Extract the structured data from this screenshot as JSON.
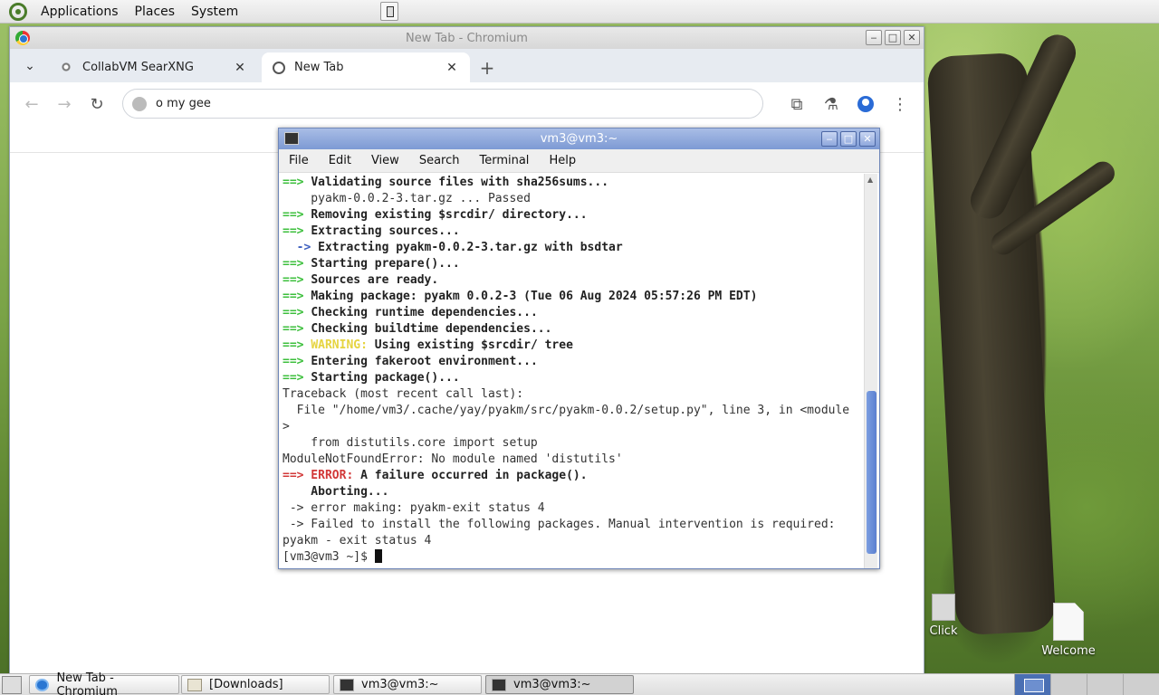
{
  "top_panel": {
    "menus": [
      "Applications",
      "Places",
      "System"
    ]
  },
  "chromium": {
    "window_title": "New Tab - Chromium",
    "tabs": [
      {
        "label": "CollabVM SearXNG",
        "active": false
      },
      {
        "label": "New Tab",
        "active": true
      }
    ],
    "new_tab_symbol": "+",
    "omnibox": {
      "value": "o my gee"
    }
  },
  "terminal": {
    "window_title": "vm3@vm3:~",
    "menus": [
      "File",
      "Edit",
      "View",
      "Search",
      "Terminal",
      "Help"
    ],
    "lines": [
      [
        [
          "g",
          "==> "
        ],
        [
          "b",
          "Validating source files with sha256sums..."
        ]
      ],
      [
        [
          "n",
          "    pyakm-0.0.2-3.tar.gz ... Passed"
        ]
      ],
      [
        [
          "g",
          "==> "
        ],
        [
          "b",
          "Removing existing $srcdir/ directory..."
        ]
      ],
      [
        [
          "g",
          "==> "
        ],
        [
          "b",
          "Extracting sources..."
        ]
      ],
      [
        [
          "n",
          "  "
        ],
        [
          "bl",
          "-> "
        ],
        [
          "b",
          "Extracting pyakm-0.0.2-3.tar.gz with bsdtar"
        ]
      ],
      [
        [
          "g",
          "==> "
        ],
        [
          "b",
          "Starting prepare()..."
        ]
      ],
      [
        [
          "g",
          "==> "
        ],
        [
          "b",
          "Sources are ready."
        ]
      ],
      [
        [
          "g",
          "==> "
        ],
        [
          "b",
          "Making package: pyakm 0.0.2-3 (Tue 06 Aug 2024 05:57:26 PM EDT)"
        ]
      ],
      [
        [
          "g",
          "==> "
        ],
        [
          "b",
          "Checking runtime dependencies..."
        ]
      ],
      [
        [
          "g",
          "==> "
        ],
        [
          "b",
          "Checking buildtime dependencies..."
        ]
      ],
      [
        [
          "g",
          "==> "
        ],
        [
          "y",
          "WARNING:"
        ],
        [
          "b",
          " Using existing $srcdir/ tree"
        ]
      ],
      [
        [
          "g",
          "==> "
        ],
        [
          "b",
          "Entering fakeroot environment..."
        ]
      ],
      [
        [
          "g",
          "==> "
        ],
        [
          "b",
          "Starting package()..."
        ]
      ],
      [
        [
          "n",
          "Traceback (most recent call last):"
        ]
      ],
      [
        [
          "n",
          "  File \"/home/vm3/.cache/yay/pyakm/src/pyakm-0.0.2/setup.py\", line 3, in <module"
        ]
      ],
      [
        [
          "n",
          ">"
        ]
      ],
      [
        [
          "n",
          "    from distutils.core import setup"
        ]
      ],
      [
        [
          "n",
          "ModuleNotFoundError: No module named 'distutils'"
        ]
      ],
      [
        [
          "r",
          "==> ERROR:"
        ],
        [
          "b",
          " A failure occurred in package()."
        ]
      ],
      [
        [
          "b",
          "    Aborting..."
        ]
      ],
      [
        [
          "n",
          " -> error making: pyakm-exit status 4"
        ]
      ],
      [
        [
          "n",
          " -> Failed to install the following packages. Manual intervention is required:"
        ]
      ],
      [
        [
          "n",
          "pyakm - exit status 4"
        ]
      ],
      [
        [
          "n",
          "[vm3@vm3 ~]$ "
        ]
      ]
    ]
  },
  "desktop_icons": [
    {
      "label": "Click",
      "type": "box"
    },
    {
      "label": "Welcome",
      "type": "doc"
    }
  ],
  "taskbar": {
    "tasks": [
      {
        "label": "New Tab - Chromium",
        "icon": "chromium-icon",
        "active": false
      },
      {
        "label": "[Downloads]",
        "icon": "folder-icon",
        "active": false
      },
      {
        "label": "vm3@vm3:~",
        "icon": "terminal-icon",
        "active": false
      },
      {
        "label": "vm3@vm3:~",
        "icon": "terminal-icon",
        "active": true
      }
    ]
  }
}
